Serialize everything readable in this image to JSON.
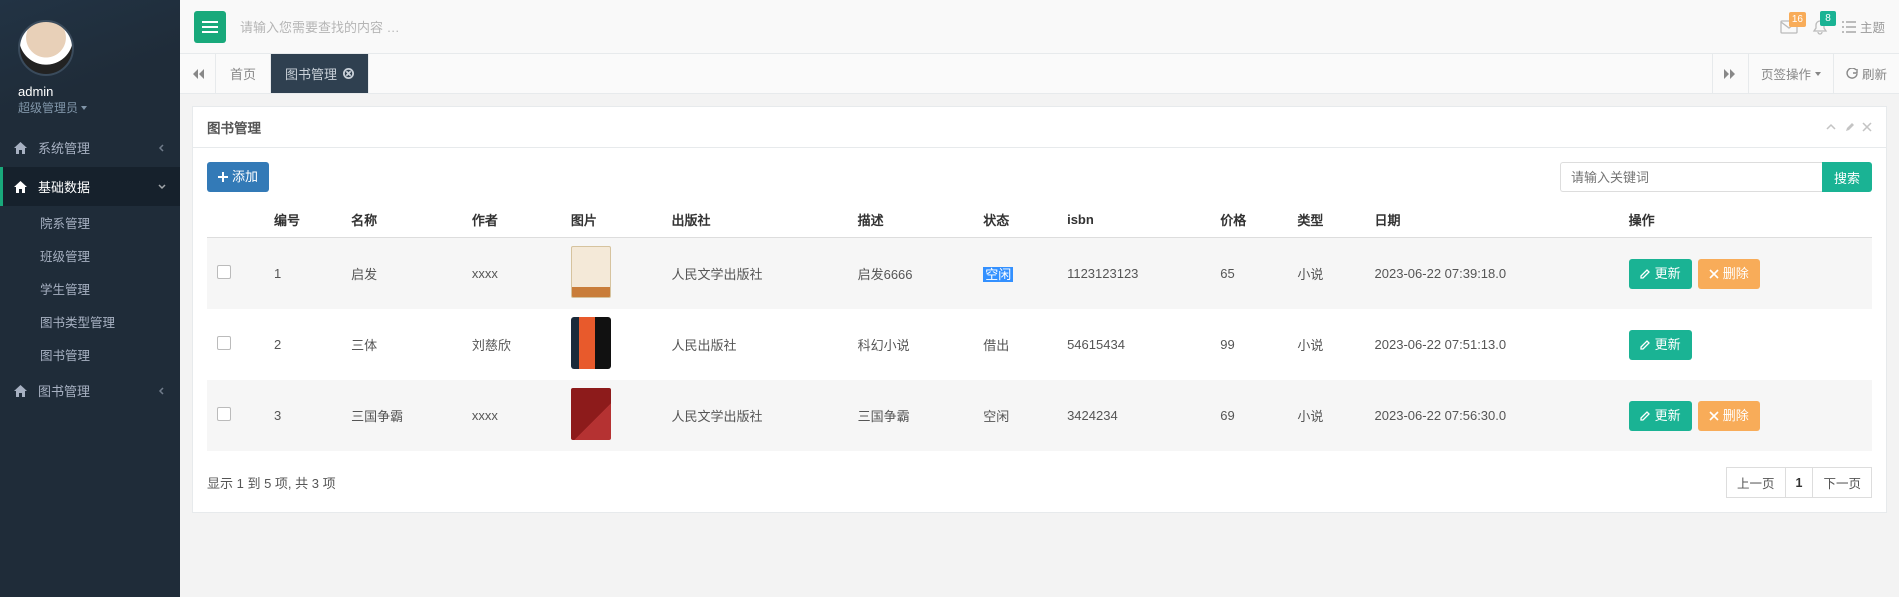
{
  "user": {
    "name": "admin",
    "role": "超级管理员"
  },
  "sidebar": {
    "menus": [
      {
        "label": "系统管理",
        "icon": "home",
        "active": false,
        "chev": "right"
      },
      {
        "label": "基础数据",
        "icon": "home",
        "active": true,
        "chev": "down",
        "children": [
          {
            "label": "院系管理"
          },
          {
            "label": "班级管理"
          },
          {
            "label": "学生管理"
          },
          {
            "label": "图书类型管理"
          },
          {
            "label": "图书管理"
          }
        ]
      },
      {
        "label": "图书管理",
        "icon": "home",
        "active": false,
        "chev": "right"
      }
    ]
  },
  "topbar": {
    "search_placeholder": "请输入您需要查找的内容 …",
    "mail_badge": "16",
    "bell_badge": "8",
    "theme_label": "主题"
  },
  "tabs": {
    "nav_prev": "◀◀",
    "nav_next": "▶▶",
    "items": [
      {
        "label": "首页",
        "active": false,
        "closable": false
      },
      {
        "label": "图书管理",
        "active": true,
        "closable": true
      }
    ],
    "op_label": "页签操作",
    "refresh_label": "刷新"
  },
  "panel": {
    "title": "图书管理",
    "add_label": "添加",
    "search_placeholder": "请输入关键词",
    "search_btn": "搜索",
    "columns": [
      "",
      "编号",
      "名称",
      "作者",
      "图片",
      "出版社",
      "描述",
      "状态",
      "isbn",
      "价格",
      "类型",
      "日期",
      "操作"
    ],
    "rows": [
      {
        "id": "1",
        "name": "启发",
        "author": "xxxx",
        "publisher": "人民文学出版社",
        "desc": "启发6666",
        "status": "空闲",
        "status_hl": true,
        "isbn": "1123123123",
        "price": "65",
        "type": "小说",
        "date": "2023-06-22 07:39:18.0",
        "thumb": "thumb1",
        "show_delete": true
      },
      {
        "id": "2",
        "name": "三体",
        "author": "刘慈欣",
        "publisher": "人民出版社",
        "desc": "科幻小说",
        "status": "借出",
        "status_hl": false,
        "isbn": "54615434",
        "price": "99",
        "type": "小说",
        "date": "2023-06-22 07:51:13.0",
        "thumb": "thumb2",
        "show_delete": false
      },
      {
        "id": "3",
        "name": "三国争霸",
        "author": "xxxx",
        "publisher": "人民文学出版社",
        "desc": "三国争霸",
        "status": "空闲",
        "status_hl": false,
        "isbn": "3424234",
        "price": "69",
        "type": "小说",
        "date": "2023-06-22 07:56:30.0",
        "thumb": "thumb3",
        "show_delete": true
      }
    ],
    "update_label": "更新",
    "delete_label": "删除",
    "footer_info": "显示 1 到 5 项, 共 3 项",
    "pager": {
      "prev": "上一页",
      "page": "1",
      "next": "下一页"
    }
  }
}
